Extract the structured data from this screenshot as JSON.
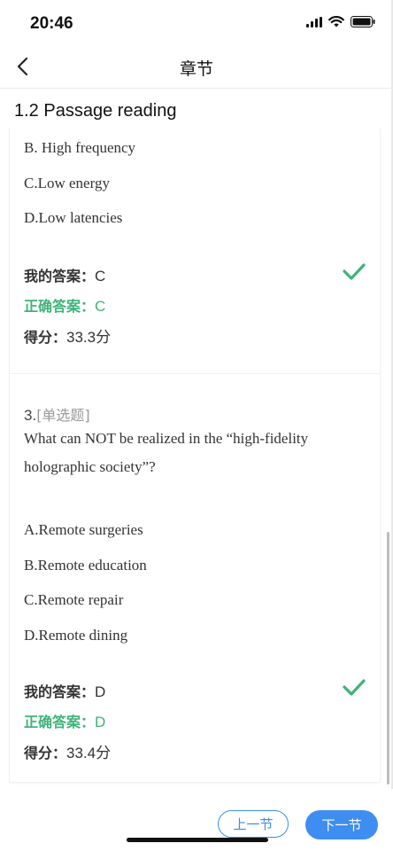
{
  "status": {
    "time": "20:46"
  },
  "nav": {
    "title": "章节"
  },
  "section": {
    "title": "1.2 Passage reading"
  },
  "question2": {
    "options": [
      "B. High frequency",
      "C.Low energy",
      "D.Low latencies"
    ],
    "my_answer_label": "我的答案：",
    "my_answer": "C",
    "correct_answer_label": "正确答案：",
    "correct_answer": "C",
    "score_label": "得分：",
    "score": "33.3分"
  },
  "question3": {
    "number": "3.",
    "type": "[单选题]",
    "text": "What can NOT be realized in the “high-fidelity holographic society”?",
    "options": [
      "A.Remote surgeries",
      "B.Remote education",
      "C.Remote repair",
      "D.Remote dining"
    ],
    "my_answer_label": "我的答案：",
    "my_answer": "D",
    "correct_answer_label": "正确答案：",
    "correct_answer": "D",
    "score_label": "得分：",
    "score": "33.4分"
  },
  "footer": {
    "prev_label": "上一节",
    "next_label": "下一节"
  },
  "colors": {
    "correct": "#3fb378",
    "accent": "#3d8ef0"
  },
  "icons": {
    "back": "chevron-left-icon",
    "check": "check-icon",
    "signal": "signal-icon",
    "wifi": "wifi-icon",
    "battery": "battery-icon"
  }
}
